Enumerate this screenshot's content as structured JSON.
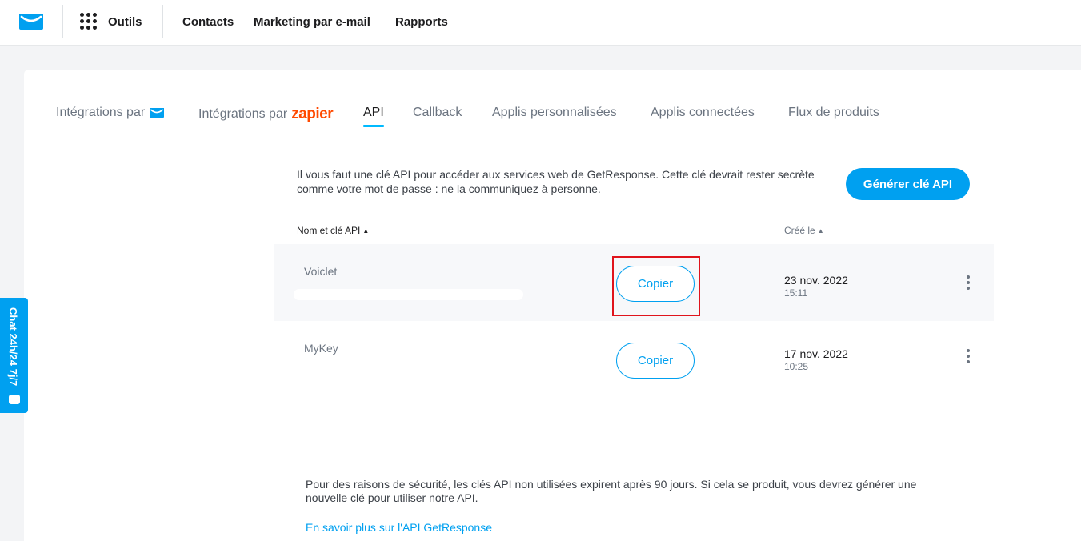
{
  "topbar": {
    "tools_label": "Outils",
    "nav": [
      "Contacts",
      "Marketing par e-mail",
      "Rapports"
    ]
  },
  "tabs": {
    "integrations_gr_label": "Intégrations par",
    "integrations_zapier_label": "Intégrations par",
    "zapier_logo_text": "zapier",
    "api": "API",
    "callback": "Callback",
    "custom_apps": "Applis personnalisées",
    "connected_apps": "Applis connectées",
    "product_feeds": "Flux de produits",
    "active": "API"
  },
  "api_panel": {
    "intro": "Il vous faut une clé API pour accéder aux services web de GetResponse. Cette clé devrait rester secrète comme votre mot de passe : ne la communiquez à personne.",
    "generate_button": "Générer clé API",
    "col_name": "Nom et clé API",
    "col_created": "Créé le",
    "keys": [
      {
        "name": "Voiclet",
        "copy_label": "Copier",
        "date": "23 nov. 2022",
        "time": "15:11"
      },
      {
        "name": "MyKey",
        "copy_label": "Copier",
        "date": "17 nov. 2022",
        "time": "10:25"
      }
    ],
    "security_note": "Pour des raisons de sécurité, les clés API non utilisées expirent après 90 jours. Si cela se produit, vous devrez générer une nouvelle clé pour utiliser notre API.",
    "learn_more_link": "En savoir plus sur l'API GetResponse"
  },
  "chat_widget": {
    "label": "Chat 24h/24 7j/7"
  },
  "colors": {
    "accent": "#00a0f0",
    "zapier": "#ff4a00",
    "highlight": "#e0141c"
  }
}
